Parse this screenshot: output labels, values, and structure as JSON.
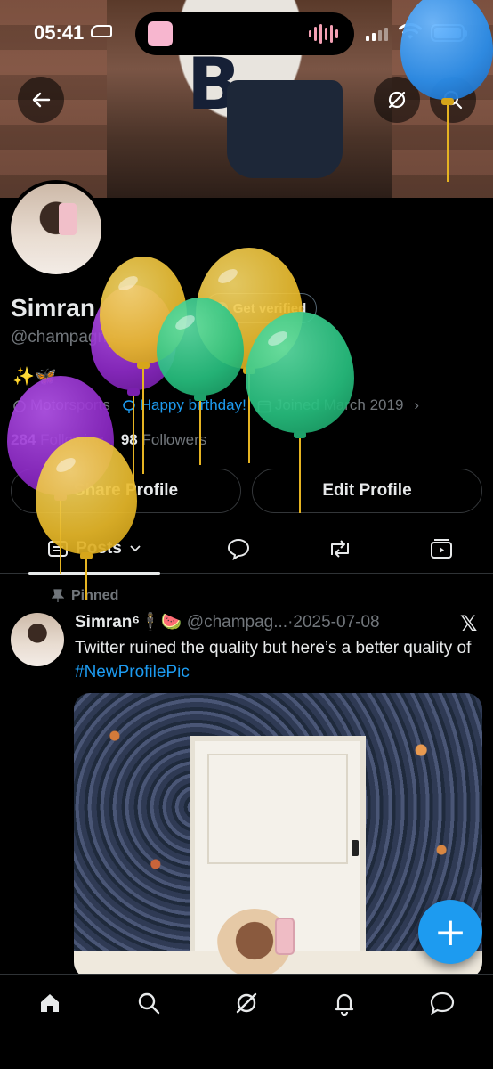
{
  "status_bar": {
    "time": "05:41"
  },
  "header": {
    "back_icon": "arrow-left-icon",
    "grok_icon": "grok-icon",
    "search_icon": "search-icon"
  },
  "profile": {
    "display_name": "Simran",
    "verify_label": "Get verified",
    "handle": "@champagne",
    "bio": "✨🦋",
    "category": "Motorsports",
    "birthday": "Happy birthday!",
    "joined": "Joined March 2019",
    "following_count": "284",
    "following_label": "Following",
    "followers_count": "98",
    "followers_label": "Followers",
    "share_label": "Share Profile",
    "edit_label": "Edit Profile"
  },
  "tabs": {
    "posts_label": "Posts"
  },
  "post": {
    "pinned_label": "Pinned",
    "author_name": "Simran⁶",
    "author_emoji": "🕴🍉",
    "author_handle": "@champag...",
    "separator": "·",
    "date": "2025-07-08",
    "text": "Twitter ruined the quality but here’s a better quality of",
    "hashtag": "#NewProfilePic"
  },
  "fab": {
    "label": "+"
  },
  "colors": {
    "accent": "#1d9bf0",
    "background": "#000000",
    "balloon_yellow": "#e8b92a",
    "balloon_green": "#27c07f",
    "balloon_purple": "#8e2ac7",
    "balloon_blue": "#2a8ce8"
  }
}
